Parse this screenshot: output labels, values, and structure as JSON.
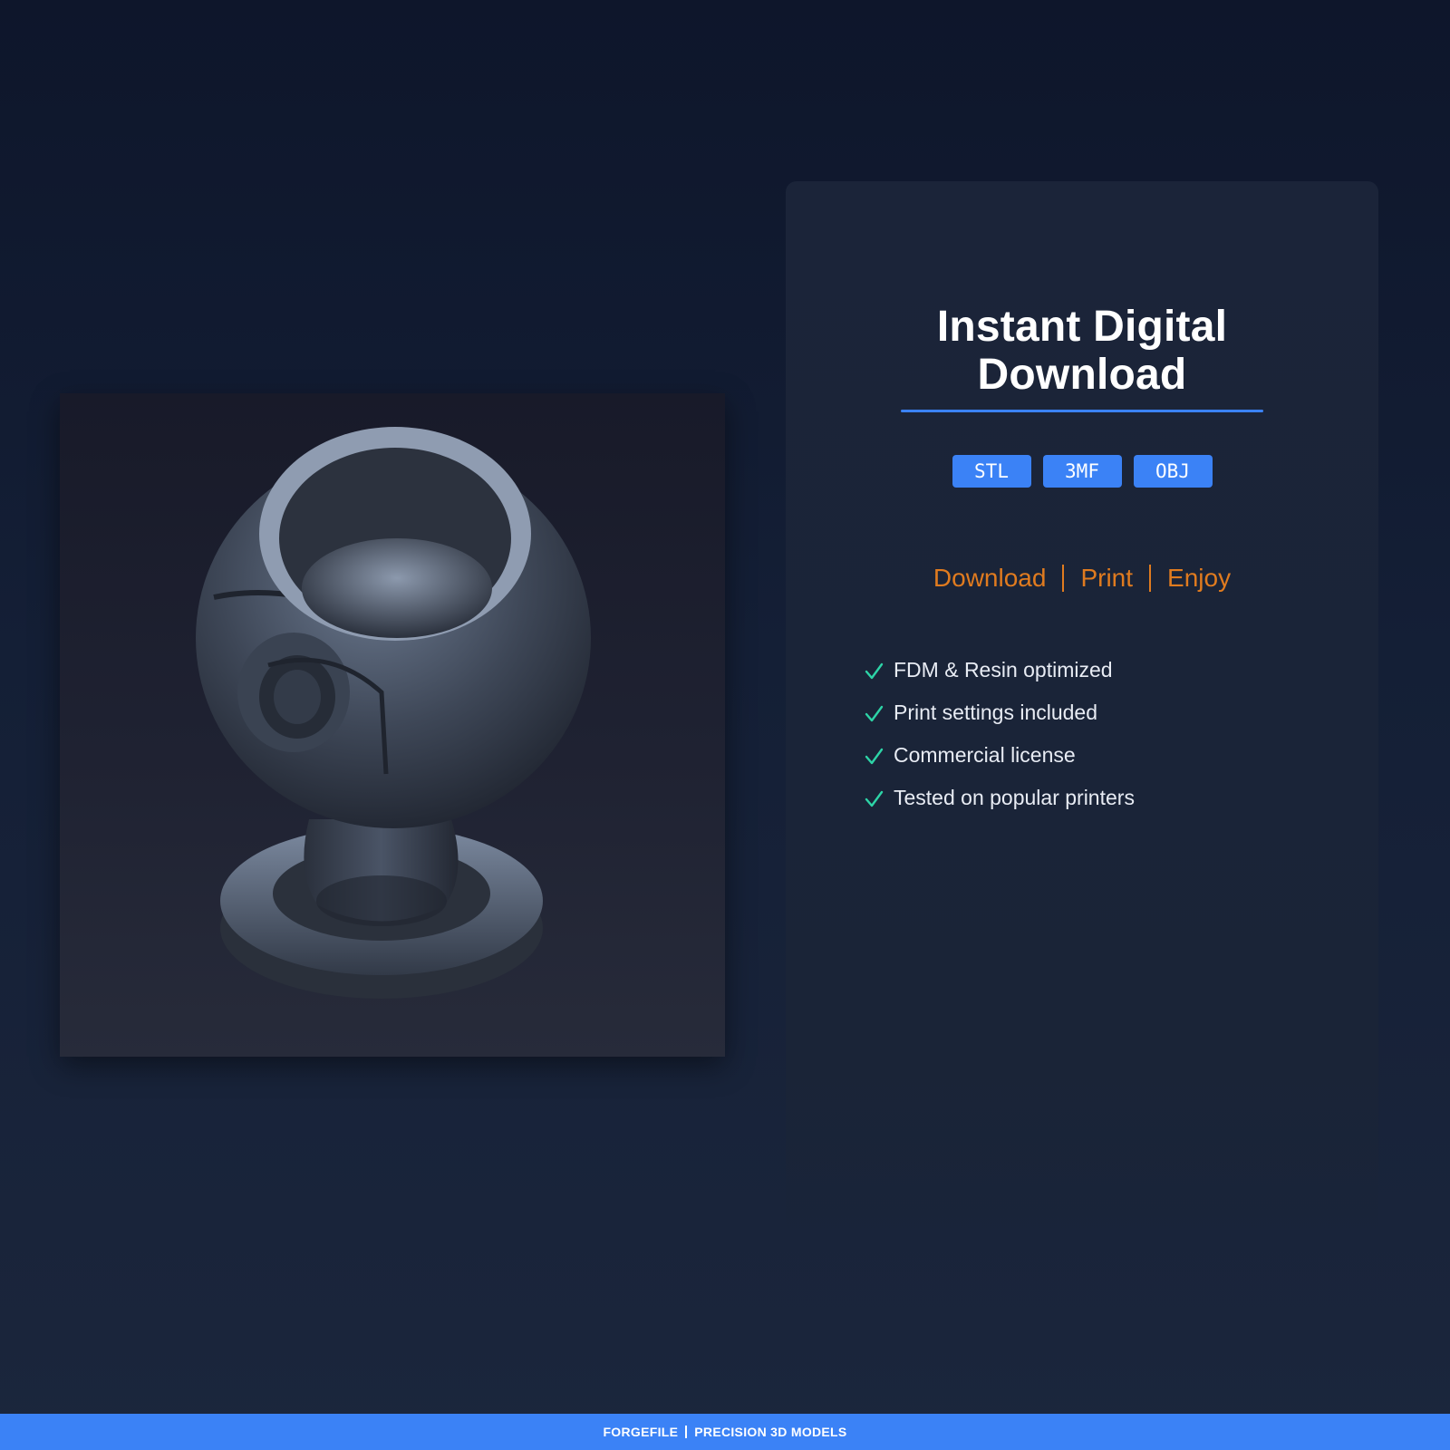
{
  "product_image": {
    "alt_icon": "3d-model-render"
  },
  "card": {
    "title_line1": "Instant Digital",
    "title_line2": "Download",
    "formats": [
      "STL",
      "3MF",
      "OBJ"
    ],
    "steps": [
      "Download",
      "Print",
      "Enjoy"
    ],
    "features": [
      "FDM & Resin optimized",
      "Print settings included",
      "Commercial license",
      "Tested on popular printers"
    ]
  },
  "footer": {
    "brand": "FORGEFILE",
    "tagline": "PRECISION 3D MODELS"
  },
  "colors": {
    "accent": "#3b82f6",
    "steps": "#e07b1f",
    "check": "#2dd4a7"
  }
}
